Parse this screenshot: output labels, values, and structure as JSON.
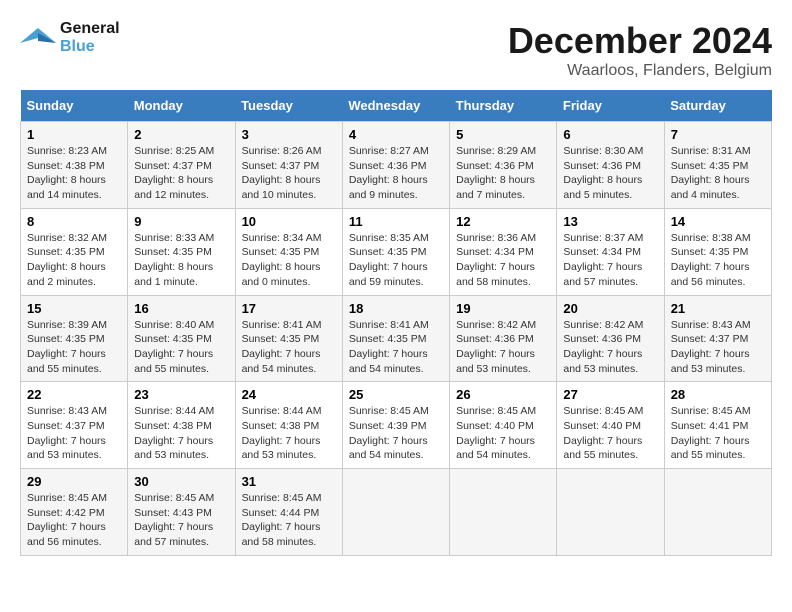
{
  "header": {
    "logo_line1": "General",
    "logo_line2": "Blue",
    "month": "December 2024",
    "location": "Waarloos, Flanders, Belgium"
  },
  "days_of_week": [
    "Sunday",
    "Monday",
    "Tuesday",
    "Wednesday",
    "Thursday",
    "Friday",
    "Saturday"
  ],
  "weeks": [
    [
      {
        "day": "1",
        "sunrise": "Sunrise: 8:23 AM",
        "sunset": "Sunset: 4:38 PM",
        "daylight": "Daylight: 8 hours and 14 minutes."
      },
      {
        "day": "2",
        "sunrise": "Sunrise: 8:25 AM",
        "sunset": "Sunset: 4:37 PM",
        "daylight": "Daylight: 8 hours and 12 minutes."
      },
      {
        "day": "3",
        "sunrise": "Sunrise: 8:26 AM",
        "sunset": "Sunset: 4:37 PM",
        "daylight": "Daylight: 8 hours and 10 minutes."
      },
      {
        "day": "4",
        "sunrise": "Sunrise: 8:27 AM",
        "sunset": "Sunset: 4:36 PM",
        "daylight": "Daylight: 8 hours and 9 minutes."
      },
      {
        "day": "5",
        "sunrise": "Sunrise: 8:29 AM",
        "sunset": "Sunset: 4:36 PM",
        "daylight": "Daylight: 8 hours and 7 minutes."
      },
      {
        "day": "6",
        "sunrise": "Sunrise: 8:30 AM",
        "sunset": "Sunset: 4:36 PM",
        "daylight": "Daylight: 8 hours and 5 minutes."
      },
      {
        "day": "7",
        "sunrise": "Sunrise: 8:31 AM",
        "sunset": "Sunset: 4:35 PM",
        "daylight": "Daylight: 8 hours and 4 minutes."
      }
    ],
    [
      {
        "day": "8",
        "sunrise": "Sunrise: 8:32 AM",
        "sunset": "Sunset: 4:35 PM",
        "daylight": "Daylight: 8 hours and 2 minutes."
      },
      {
        "day": "9",
        "sunrise": "Sunrise: 8:33 AM",
        "sunset": "Sunset: 4:35 PM",
        "daylight": "Daylight: 8 hours and 1 minute."
      },
      {
        "day": "10",
        "sunrise": "Sunrise: 8:34 AM",
        "sunset": "Sunset: 4:35 PM",
        "daylight": "Daylight: 8 hours and 0 minutes."
      },
      {
        "day": "11",
        "sunrise": "Sunrise: 8:35 AM",
        "sunset": "Sunset: 4:35 PM",
        "daylight": "Daylight: 7 hours and 59 minutes."
      },
      {
        "day": "12",
        "sunrise": "Sunrise: 8:36 AM",
        "sunset": "Sunset: 4:34 PM",
        "daylight": "Daylight: 7 hours and 58 minutes."
      },
      {
        "day": "13",
        "sunrise": "Sunrise: 8:37 AM",
        "sunset": "Sunset: 4:34 PM",
        "daylight": "Daylight: 7 hours and 57 minutes."
      },
      {
        "day": "14",
        "sunrise": "Sunrise: 8:38 AM",
        "sunset": "Sunset: 4:35 PM",
        "daylight": "Daylight: 7 hours and 56 minutes."
      }
    ],
    [
      {
        "day": "15",
        "sunrise": "Sunrise: 8:39 AM",
        "sunset": "Sunset: 4:35 PM",
        "daylight": "Daylight: 7 hours and 55 minutes."
      },
      {
        "day": "16",
        "sunrise": "Sunrise: 8:40 AM",
        "sunset": "Sunset: 4:35 PM",
        "daylight": "Daylight: 7 hours and 55 minutes."
      },
      {
        "day": "17",
        "sunrise": "Sunrise: 8:41 AM",
        "sunset": "Sunset: 4:35 PM",
        "daylight": "Daylight: 7 hours and 54 minutes."
      },
      {
        "day": "18",
        "sunrise": "Sunrise: 8:41 AM",
        "sunset": "Sunset: 4:35 PM",
        "daylight": "Daylight: 7 hours and 54 minutes."
      },
      {
        "day": "19",
        "sunrise": "Sunrise: 8:42 AM",
        "sunset": "Sunset: 4:36 PM",
        "daylight": "Daylight: 7 hours and 53 minutes."
      },
      {
        "day": "20",
        "sunrise": "Sunrise: 8:42 AM",
        "sunset": "Sunset: 4:36 PM",
        "daylight": "Daylight: 7 hours and 53 minutes."
      },
      {
        "day": "21",
        "sunrise": "Sunrise: 8:43 AM",
        "sunset": "Sunset: 4:37 PM",
        "daylight": "Daylight: 7 hours and 53 minutes."
      }
    ],
    [
      {
        "day": "22",
        "sunrise": "Sunrise: 8:43 AM",
        "sunset": "Sunset: 4:37 PM",
        "daylight": "Daylight: 7 hours and 53 minutes."
      },
      {
        "day": "23",
        "sunrise": "Sunrise: 8:44 AM",
        "sunset": "Sunset: 4:38 PM",
        "daylight": "Daylight: 7 hours and 53 minutes."
      },
      {
        "day": "24",
        "sunrise": "Sunrise: 8:44 AM",
        "sunset": "Sunset: 4:38 PM",
        "daylight": "Daylight: 7 hours and 53 minutes."
      },
      {
        "day": "25",
        "sunrise": "Sunrise: 8:45 AM",
        "sunset": "Sunset: 4:39 PM",
        "daylight": "Daylight: 7 hours and 54 minutes."
      },
      {
        "day": "26",
        "sunrise": "Sunrise: 8:45 AM",
        "sunset": "Sunset: 4:40 PM",
        "daylight": "Daylight: 7 hours and 54 minutes."
      },
      {
        "day": "27",
        "sunrise": "Sunrise: 8:45 AM",
        "sunset": "Sunset: 4:40 PM",
        "daylight": "Daylight: 7 hours and 55 minutes."
      },
      {
        "day": "28",
        "sunrise": "Sunrise: 8:45 AM",
        "sunset": "Sunset: 4:41 PM",
        "daylight": "Daylight: 7 hours and 55 minutes."
      }
    ],
    [
      {
        "day": "29",
        "sunrise": "Sunrise: 8:45 AM",
        "sunset": "Sunset: 4:42 PM",
        "daylight": "Daylight: 7 hours and 56 minutes."
      },
      {
        "day": "30",
        "sunrise": "Sunrise: 8:45 AM",
        "sunset": "Sunset: 4:43 PM",
        "daylight": "Daylight: 7 hours and 57 minutes."
      },
      {
        "day": "31",
        "sunrise": "Sunrise: 8:45 AM",
        "sunset": "Sunset: 4:44 PM",
        "daylight": "Daylight: 7 hours and 58 minutes."
      },
      {
        "day": "",
        "sunrise": "",
        "sunset": "",
        "daylight": ""
      },
      {
        "day": "",
        "sunrise": "",
        "sunset": "",
        "daylight": ""
      },
      {
        "day": "",
        "sunrise": "",
        "sunset": "",
        "daylight": ""
      },
      {
        "day": "",
        "sunrise": "",
        "sunset": "",
        "daylight": ""
      }
    ]
  ]
}
